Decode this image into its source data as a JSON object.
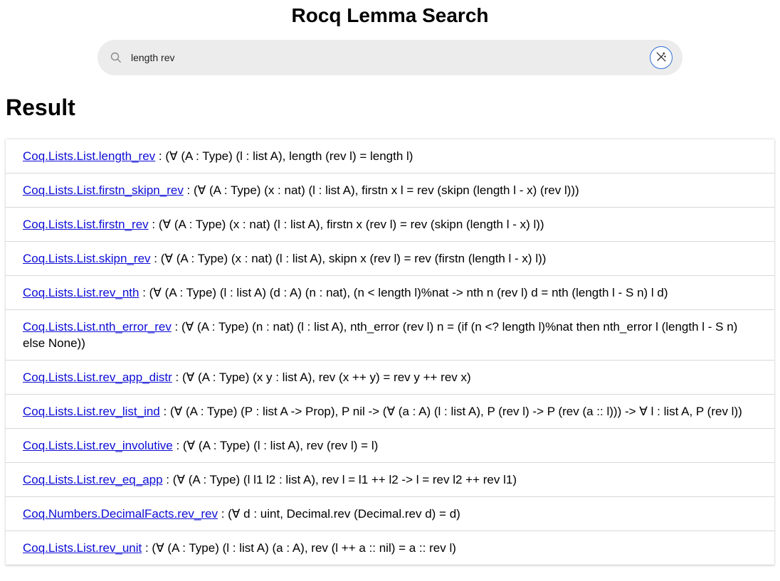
{
  "app": {
    "title": "Rocq Lemma Search"
  },
  "search": {
    "value": "length rev",
    "icons": {
      "search": "search-icon",
      "mode": "magic-wand-off-icon"
    },
    "accent_color": "#2f6fd6"
  },
  "results": {
    "heading": "Result",
    "link_color": "#0d0dd6",
    "separator": " : ",
    "items": [
      {
        "name": "Coq.Lists.List.length_rev",
        "type": "(∀ (A : Type) (l : list A), length (rev l) = length l)"
      },
      {
        "name": "Coq.Lists.List.firstn_skipn_rev",
        "type": "(∀ (A : Type) (x : nat) (l : list A), firstn x l = rev (skipn (length l - x) (rev l)))"
      },
      {
        "name": "Coq.Lists.List.firstn_rev",
        "type": "(∀ (A : Type) (x : nat) (l : list A), firstn x (rev l) = rev (skipn (length l - x) l))"
      },
      {
        "name": "Coq.Lists.List.skipn_rev",
        "type": "(∀ (A : Type) (x : nat) (l : list A), skipn x (rev l) = rev (firstn (length l - x) l))"
      },
      {
        "name": "Coq.Lists.List.rev_nth",
        "type": "(∀ (A : Type) (l : list A) (d : A) (n : nat), (n < length l)%nat -> nth n (rev l) d = nth (length l - S n) l d)"
      },
      {
        "name": "Coq.Lists.List.nth_error_rev",
        "type": "(∀ (A : Type) (n : nat) (l : list A), nth_error (rev l) n = (if (n <? length l)%nat then nth_error l (length l - S n) else None))"
      },
      {
        "name": "Coq.Lists.List.rev_app_distr",
        "type": "(∀ (A : Type) (x y : list A), rev (x ++ y) = rev y ++ rev x)"
      },
      {
        "name": "Coq.Lists.List.rev_list_ind",
        "type": "(∀ (A : Type) (P : list A -> Prop), P nil -> (∀ (a : A) (l : list A), P (rev l) -> P (rev (a :: l))) -> ∀ l : list A, P (rev l))"
      },
      {
        "name": "Coq.Lists.List.rev_involutive",
        "type": "(∀ (A : Type) (l : list A), rev (rev l) = l)"
      },
      {
        "name": "Coq.Lists.List.rev_eq_app",
        "type": "(∀ (A : Type) (l l1 l2 : list A), rev l = l1 ++ l2 -> l = rev l2 ++ rev l1)"
      },
      {
        "name": "Coq.Numbers.DecimalFacts.rev_rev",
        "type": "(∀ d : uint, Decimal.rev (Decimal.rev d) = d)"
      },
      {
        "name": "Coq.Lists.List.rev_unit",
        "type": "(∀ (A : Type) (l : list A) (a : A), rev (l ++ a :: nil) = a :: rev l)"
      }
    ]
  }
}
